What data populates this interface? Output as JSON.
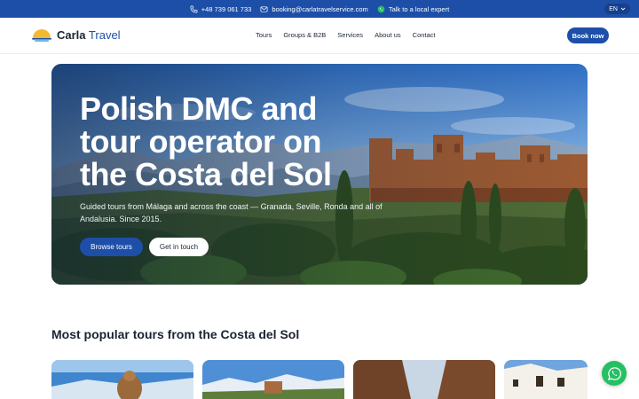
{
  "topbar": {
    "phone": "+48 739 061 733",
    "email": "booking@carlatravelservice.com",
    "whatsapp": "Talk to a local expert",
    "language": "EN",
    "icons": [
      "phone-icon",
      "mail-icon",
      "whatsapp-icon",
      "chevron-down-icon"
    ]
  },
  "header": {
    "brand_bold": "Carla",
    "brand_light": "Travel",
    "nav": [
      "Tours",
      "Groups & B2B",
      "Services",
      "About us",
      "Contact"
    ],
    "cta": "Book now"
  },
  "hero": {
    "title_lines": [
      "Polish DMC and",
      "tour operator on",
      "the Costa del Sol"
    ],
    "subtitle": "Guided tours from Málaga and across the coast — Granada, Seville, Ronda and all of Andalusia. Since 2015.",
    "primary_button": "Browse tours",
    "secondary_button": "Get in touch"
  },
  "popular": {
    "title": "Most popular tours from the Costa del Sol"
  },
  "colors": {
    "primary": "#1d4fa8",
    "whatsapp": "#25c063",
    "text": "#1b2433"
  }
}
